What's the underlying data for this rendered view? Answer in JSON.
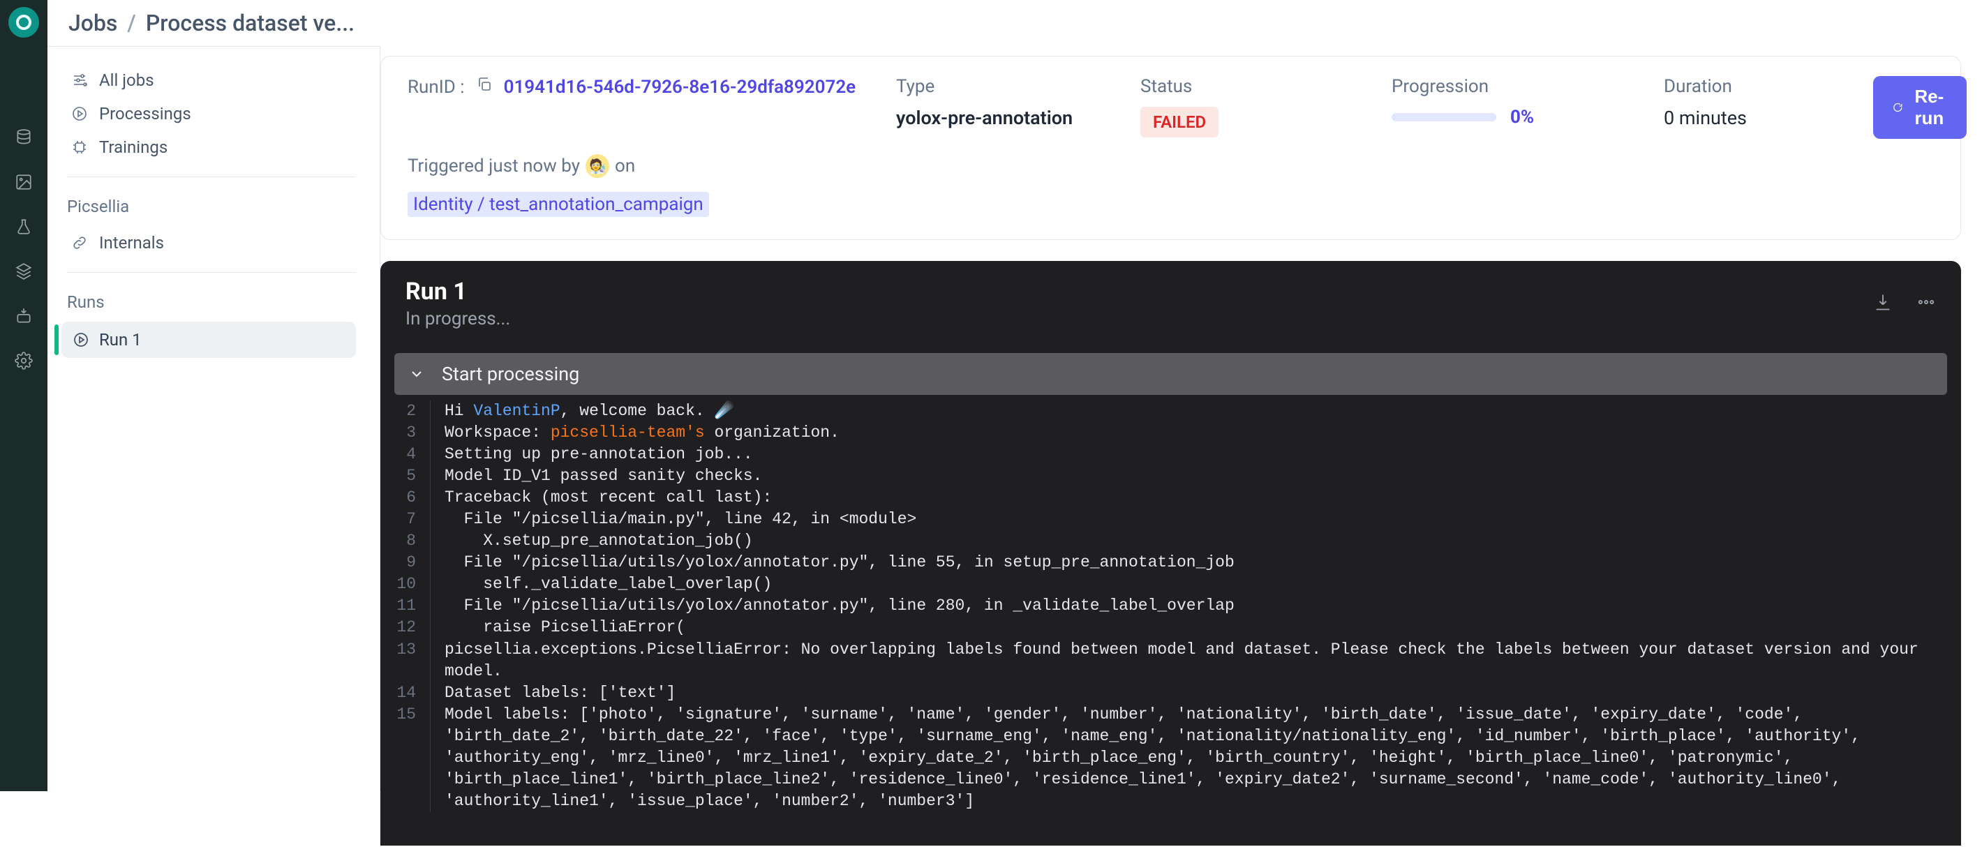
{
  "breadcrumb": {
    "root": "Jobs",
    "separator": "/",
    "current": "Process dataset ve..."
  },
  "sidebar": {
    "nav": [
      {
        "icon": "sliders",
        "label": "All jobs"
      },
      {
        "icon": "play",
        "label": "Processings"
      },
      {
        "icon": "chip",
        "label": "Trainings"
      }
    ],
    "org_label": "Picsellia",
    "org_nav": [
      {
        "icon": "link",
        "label": "Internals"
      }
    ],
    "runs_label": "Runs",
    "runs": [
      {
        "label": "Run 1"
      }
    ]
  },
  "summary": {
    "runid_label": "RunID :",
    "runid": "01941d16-546d-7926-8e16-29dfa892072e",
    "type_label": "Type",
    "type": "yolox-pre-annotation",
    "status_label": "Status",
    "status": "FAILED",
    "progression_label": "Progression",
    "progression_pct": "0%",
    "duration_label": "Duration",
    "duration": "0 minutes",
    "rerun_label": "Re-run",
    "triggered_text_1": "Triggered just now by",
    "triggered_text_2": "on",
    "avatar_emoji": "🧑‍🔬",
    "campaign": "Identity / test_annotation_campaign"
  },
  "log_panel": {
    "title": "Run 1",
    "subtitle": "In progress...",
    "section_title": "Start processing",
    "lines": [
      {
        "n": "2",
        "raw": "Hi {user}, welcome back. ☄️",
        "user": "ValentinP"
      },
      {
        "n": "3",
        "raw": "Workspace: {org} organization.",
        "org": "picsellia-team's"
      },
      {
        "n": "4",
        "raw": "Setting up pre-annotation job..."
      },
      {
        "n": "5",
        "raw": "Model ID_V1 passed sanity checks."
      },
      {
        "n": "6",
        "raw": "Traceback (most recent call last):"
      },
      {
        "n": "7",
        "raw": "  File \"/picsellia/main.py\", line 42, in <module>"
      },
      {
        "n": "8",
        "raw": "    X.setup_pre_annotation_job()"
      },
      {
        "n": "9",
        "raw": "  File \"/picsellia/utils/yolox/annotator.py\", line 55, in setup_pre_annotation_job"
      },
      {
        "n": "10",
        "raw": "    self._validate_label_overlap()"
      },
      {
        "n": "11",
        "raw": "  File \"/picsellia/utils/yolox/annotator.py\", line 280, in _validate_label_overlap"
      },
      {
        "n": "12",
        "raw": "    raise PicselliaError("
      },
      {
        "n": "13",
        "raw": "picsellia.exceptions.PicselliaError: No overlapping labels found between model and dataset. Please check the labels between your dataset version and your model."
      },
      {
        "n": "14",
        "raw": "Dataset labels: ['text']"
      },
      {
        "n": "15",
        "raw": "Model labels: ['photo', 'signature', 'surname', 'name', 'gender', 'number', 'nationality', 'birth_date', 'issue_date', 'expiry_date', 'code', 'birth_date_2', 'birth_date_22', 'face', 'type', 'surname_eng', 'name_eng', 'nationality/nationality_eng', 'id_number', 'birth_place', 'authority', 'authority_eng', 'mrz_line0', 'mrz_line1', 'expiry_date_2', 'birth_place_eng', 'birth_country', 'height', 'birth_place_line0', 'patronymic', 'birth_place_line1', 'birth_place_line2', 'residence_line0', 'residence_line1', 'expiry_date2', 'surname_second', 'name_code', 'authority_line0', 'authority_line1', 'issue_place', 'number2', 'number3']"
      }
    ]
  }
}
